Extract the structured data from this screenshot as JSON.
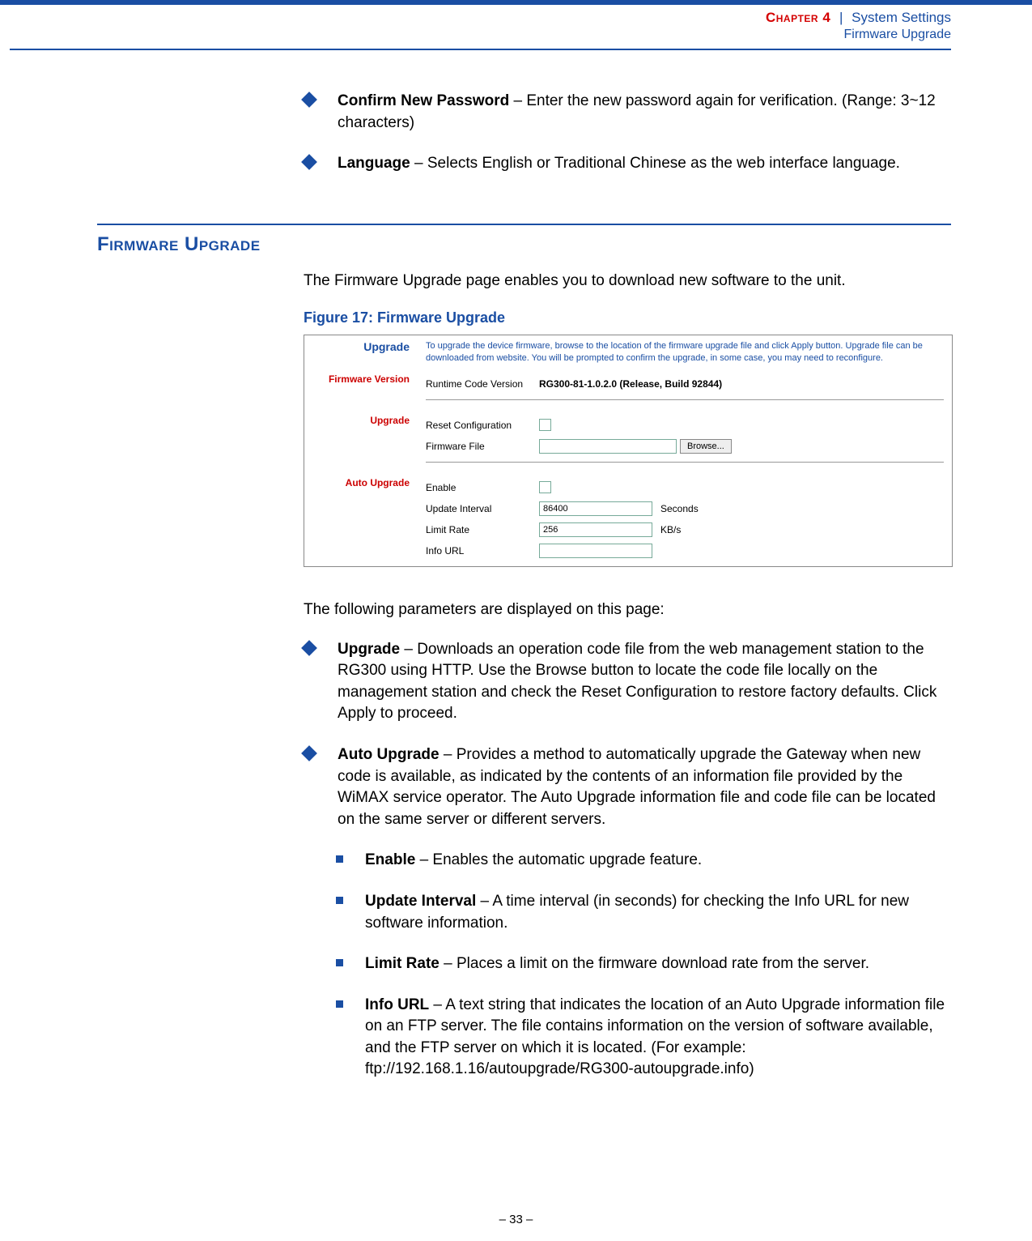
{
  "header": {
    "chapter": "Chapter 4",
    "sep": "|",
    "section_title": "System Settings",
    "subsection": "Firmware Upgrade"
  },
  "intro_bullets": [
    {
      "title": "Confirm New Password",
      "desc": " – Enter the new password again for verification. (Range: 3~12 characters)"
    },
    {
      "title": "Language",
      "desc": " – Selects English or Traditional Chinese as the web interface language."
    }
  ],
  "section": {
    "heading": "Firmware Upgrade",
    "para": "The Firmware Upgrade page enables you to download new software to the unit.",
    "fig_caption": "Figure 17:  Firmware Upgrade"
  },
  "shot": {
    "title": "Upgrade",
    "help": "To upgrade the device firmware, browse to the location of the firmware upgrade file and click Apply button. Upgrade file can be downloaded from website. You will be prompted to confirm the upgrade, in some case, you may need to reconfigure.",
    "fv_label": "Firmware Version",
    "rcv_label": "Runtime Code Version",
    "rcv_value": "RG300-81-1.0.2.0 (Release, Build 92844)",
    "upgrade_label": "Upgrade",
    "reset_label": "Reset Configuration",
    "ff_label": "Firmware File",
    "browse": "Browse...",
    "auto_label": "Auto Upgrade",
    "enable_label": "Enable",
    "ui_label": "Update Interval",
    "ui_value": "86400",
    "ui_unit": "Seconds",
    "lr_label": "Limit Rate",
    "lr_value": "256",
    "lr_unit": "KB/s",
    "iu_label": "Info URL",
    "iu_value": ""
  },
  "params_intro": "The following parameters are displayed on this page:",
  "main_bullets": [
    {
      "title": "Upgrade",
      "desc": " – Downloads an operation code file from the web management station to the RG300 using HTTP. Use the Browse button to locate the code file locally on the management station and check the Reset Configuration to restore factory defaults. Click Apply to proceed."
    },
    {
      "title": "Auto Upgrade",
      "desc": " – Provides a method to automatically upgrade the Gateway when new code is available, as indicated by the contents of an information file provided by the WiMAX service operator. The Auto Upgrade information file and code file can be located on the same server or different servers."
    }
  ],
  "sub_bullets": [
    {
      "title": "Enable",
      "desc": " – Enables the automatic upgrade feature."
    },
    {
      "title": "Update Interval",
      "desc": " – A time interval (in seconds) for checking the Info URL for new software information."
    },
    {
      "title": "Limit Rate",
      "desc": " – Places a limit on the firmware download rate from the server."
    },
    {
      "title": "Info URL",
      "desc": " – A text string that indicates the location of an Auto Upgrade information file on an FTP server. The file contains information on the version of software available, and the FTP server on which it is located. (For example: ftp://192.168.1.16/autoupgrade/RG300-autoupgrade.info)"
    }
  ],
  "footer": "–  33  –"
}
